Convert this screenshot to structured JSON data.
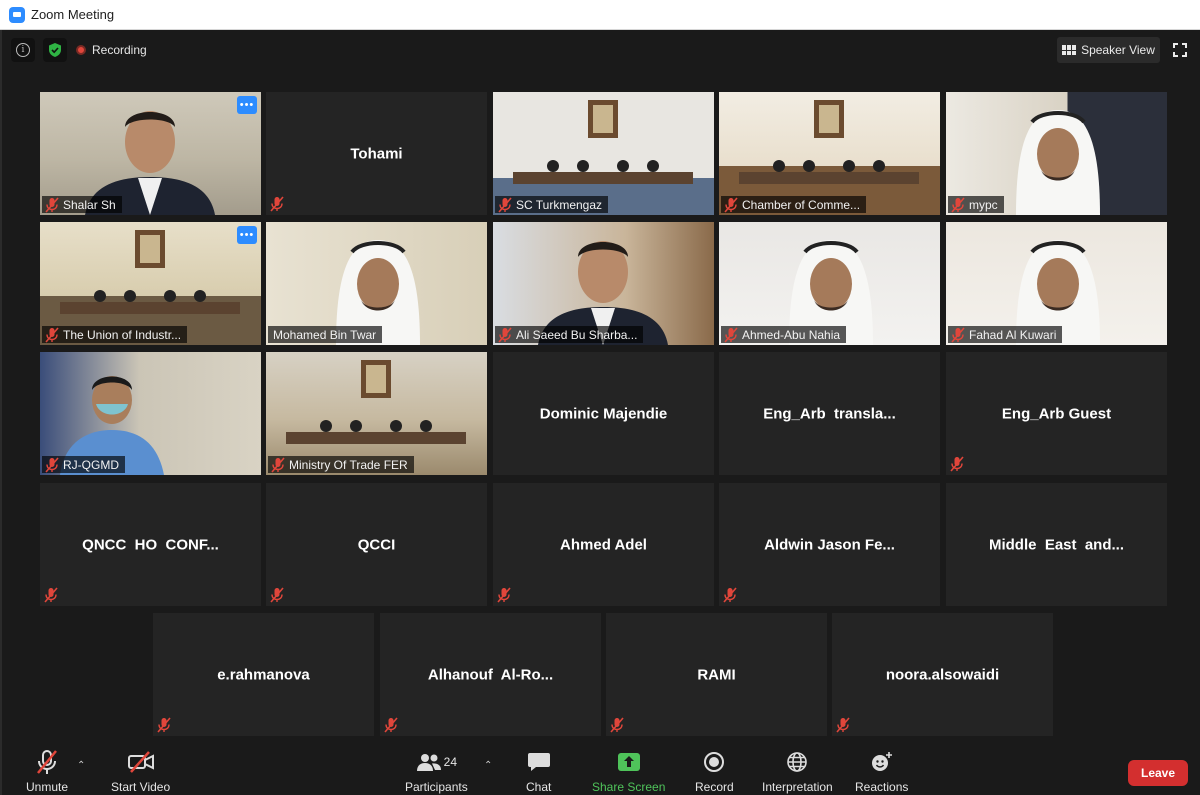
{
  "window": {
    "title": "Zoom Meeting"
  },
  "topbar": {
    "recording": "Recording",
    "speaker_view": "Speaker View"
  },
  "tiles": [
    {
      "name": "Shalar Sh",
      "video": true,
      "muted": true,
      "more_menu": true
    },
    {
      "name": "Tohami",
      "video": false,
      "muted": true
    },
    {
      "name": "SC Turkmengaz",
      "video": true,
      "muted": true
    },
    {
      "name": "Chamber of Comme...",
      "video": true,
      "muted": true
    },
    {
      "name": "mypc",
      "video": true,
      "muted": true
    },
    {
      "name": "The Union of Industr...",
      "video": true,
      "muted": true,
      "more_menu": true
    },
    {
      "name": "Mohamed Bin Twar",
      "video": true,
      "muted": false,
      "active_speaker": true
    },
    {
      "name": "Ali Saeed Bu Sharba...",
      "video": true,
      "muted": true
    },
    {
      "name": "Ahmed-Abu Nahia",
      "video": true,
      "muted": true
    },
    {
      "name": "Fahad Al Kuwari",
      "video": true,
      "muted": true
    },
    {
      "name": "RJ-QGMD",
      "video": true,
      "muted": true
    },
    {
      "name": "Ministry Of Trade FER",
      "video": true,
      "muted": true
    },
    {
      "name": "Dominic Majendie",
      "video": false,
      "muted": false
    },
    {
      "name": "Eng_Arb  transla...",
      "video": false,
      "muted": false
    },
    {
      "name": "Eng_Arb Guest",
      "video": false,
      "muted": true
    },
    {
      "name": "QNCC  HO  CONF...",
      "video": false,
      "muted": true
    },
    {
      "name": "QCCI",
      "video": false,
      "muted": true
    },
    {
      "name": "Ahmed Adel",
      "video": false,
      "muted": true
    },
    {
      "name": "Aldwin Jason Fe...",
      "video": false,
      "muted": true
    },
    {
      "name": "Middle  East  and...",
      "video": false,
      "muted": false
    },
    {
      "name": "e.rahmanova",
      "video": false,
      "muted": true
    },
    {
      "name": "Alhanouf  Al-Ro...",
      "video": false,
      "muted": true
    },
    {
      "name": "RAMI",
      "video": false,
      "muted": true
    },
    {
      "name": "noora.alsowaidi",
      "video": false,
      "muted": true
    }
  ],
  "toolbar": {
    "unmute": "Unmute",
    "start_video": "Start Video",
    "participants": "Participants",
    "participants_count": "24",
    "chat": "Chat",
    "share_screen": "Share Screen",
    "record": "Record",
    "interpretation": "Interpretation",
    "reactions": "Reactions",
    "leave": "Leave"
  },
  "colors": {
    "accent": "#2d8cff",
    "share": "#4fc35a",
    "leave": "#d32f2f",
    "active_border": "#a6e22e",
    "muted": "#e0463b"
  }
}
